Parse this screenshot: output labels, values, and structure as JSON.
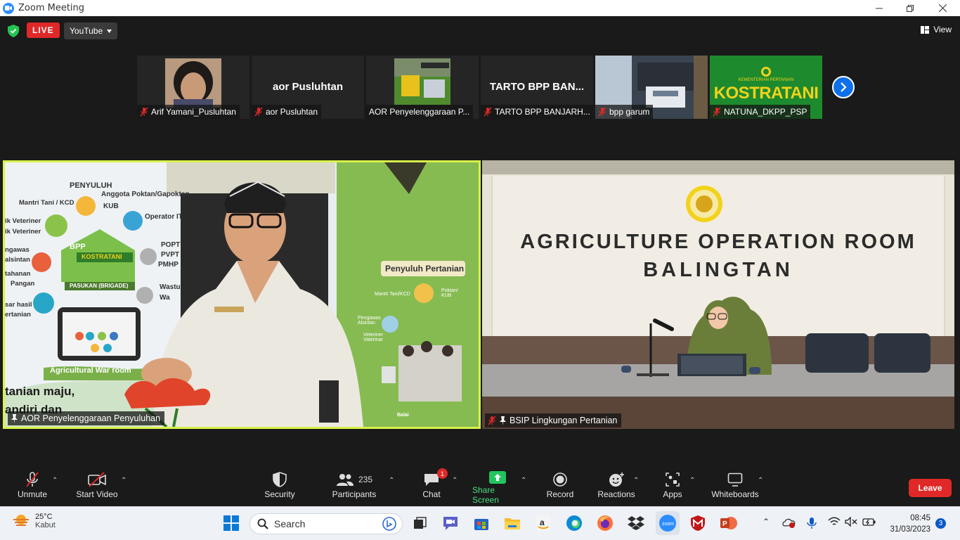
{
  "window": {
    "title": "Zoom Meeting",
    "controls": [
      "minimize",
      "restore",
      "close"
    ]
  },
  "topbar": {
    "live_label": "LIVE",
    "stream_target": "YouTube",
    "view_label": "View"
  },
  "thumbnails": [
    {
      "name": "Arif Yamani_Pusluhtan",
      "muted": true,
      "display": "photo"
    },
    {
      "name": "aor Pusluhtan",
      "muted": true,
      "display": "name",
      "big_name": "aor Pusluhtan"
    },
    {
      "name": "AOR Penyelenggaraan P...",
      "muted": false,
      "display": "video"
    },
    {
      "name": "TARTO BPP BANJARH...",
      "muted": true,
      "display": "name",
      "big_name": "TARTO BPP BAN..."
    },
    {
      "name": "bpp garum",
      "muted": true,
      "display": "video"
    },
    {
      "name": "NATUNA_DKPP_PSP",
      "muted": true,
      "display": "banner",
      "banner_small": "KEMENTERIAN PERTANIAN",
      "banner_big": "KOSTRATANI"
    }
  ],
  "main_videos": {
    "left": {
      "name": "AOR Penyelenggaraan Penyuluhan",
      "active_speaker": true,
      "backdrop": {
        "heading": "PENYULUH",
        "items": [
          "Mantri Tani / KCD",
          "Anggota Poktan/Gapoktan",
          "KUB",
          "Operator IT",
          "ik Veteriner",
          "ik Veteriner",
          "POPT",
          "PVPT",
          "PMHP",
          "ngawas",
          "alsintan",
          "tahanan",
          "Pangan",
          "Wastu",
          "Wa",
          "sar hasil",
          "ertanian"
        ],
        "house_label": "BPP",
        "house_sign": "KOSTRATANI",
        "brigade": "PASUKAN (BRIGADE)",
        "war_room": "Agricultural War room",
        "slogan_1": "tanian maju,",
        "slogan_2": "andiri dan",
        "banner_2_title": "Penyuluh Pertanian",
        "banner_2_items": [
          "Mantri Tani/KCD",
          "Poktan/ KUB",
          "Pengawas Alsintan",
          "Veteriner Vaterinar",
          "Balai"
        ]
      }
    },
    "right": {
      "name": "BSIP Lingkungan Pertanian",
      "muted": true,
      "wall_line_1": "AGRICULTURE OPERATION ROOM",
      "wall_line_2": "BALINGTAN"
    }
  },
  "toolbar": {
    "items": [
      {
        "id": "unmute",
        "label": "Unmute",
        "icon": "mic-off-icon",
        "caret": true
      },
      {
        "id": "start-video",
        "label": "Start Video",
        "icon": "video-off-icon",
        "caret": true
      },
      {
        "id": "security",
        "label": "Security",
        "icon": "shield-icon",
        "caret": false
      },
      {
        "id": "participants",
        "label": "Participants",
        "icon": "participants-icon",
        "count": "235",
        "caret": true
      },
      {
        "id": "chat",
        "label": "Chat",
        "icon": "chat-icon",
        "badge": "1",
        "caret": true
      },
      {
        "id": "share-screen",
        "label": "Share Screen",
        "icon": "share-screen-icon",
        "caret": true,
        "accent": "#22c55e"
      },
      {
        "id": "record",
        "label": "Record",
        "icon": "record-icon",
        "caret": false
      },
      {
        "id": "reactions",
        "label": "Reactions",
        "icon": "reactions-icon",
        "caret": true
      },
      {
        "id": "apps",
        "label": "Apps",
        "icon": "apps-icon",
        "caret": true
      },
      {
        "id": "whiteboards",
        "label": "Whiteboards",
        "icon": "whiteboard-icon",
        "caret": true
      }
    ],
    "leave_label": "Leave"
  },
  "taskbar": {
    "weather": {
      "temp": "25°C",
      "condition": "Kabut"
    },
    "search_label": "Search",
    "apps": [
      "windows-start-icon",
      "search-icon",
      "task-view-icon",
      "meet-icon",
      "store-icon",
      "file-explorer-icon",
      "amazon-icon",
      "edge-icon",
      "firefox-icon",
      "dropbox-icon",
      "zoom-icon",
      "mcafee-icon",
      "powerpoint-icon"
    ],
    "time": "08:45",
    "date": "31/03/2023",
    "notifications": "3"
  },
  "colors": {
    "live_red": "#e02828",
    "zoom_blue": "#0e71eb",
    "active_border": "#d8f24a",
    "share_green": "#22c55e"
  }
}
